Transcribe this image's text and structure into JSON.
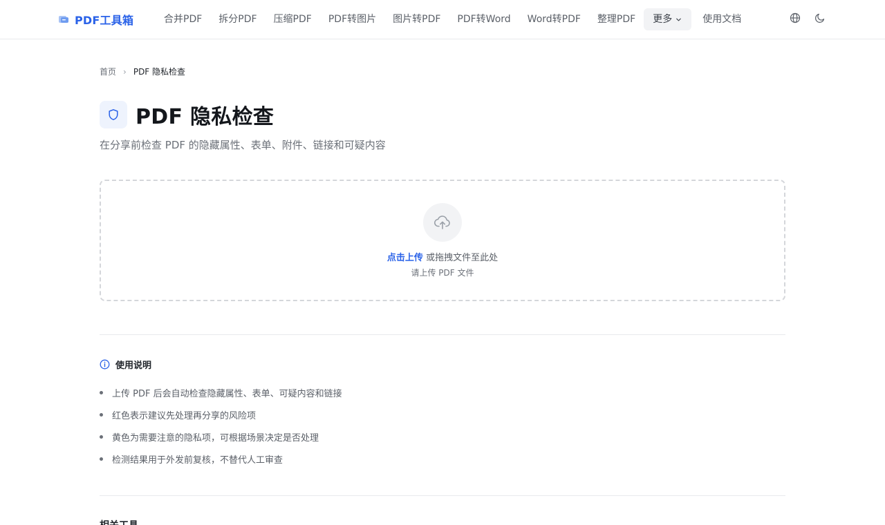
{
  "header": {
    "brand": "PDF工具箱",
    "nav": [
      "合并PDF",
      "拆分PDF",
      "压缩PDF",
      "PDF转图片",
      "图片转PDF",
      "PDF转Word",
      "Word转PDF",
      "整理PDF"
    ],
    "more_label": "更多",
    "docs_label": "使用文档",
    "icons": [
      "globe-icon",
      "moon-icon"
    ]
  },
  "breadcrumb": {
    "home": "首页",
    "separator": "›",
    "current": "PDF 隐私检查"
  },
  "page": {
    "title": "PDF 隐私检查",
    "subtitle": "在分享前检查 PDF 的隐藏属性、表单、附件、链接和可疑内容"
  },
  "upload": {
    "link_text": "点击上传",
    "rest_text": " 或拖拽文件至此处",
    "hint": "请上传 PDF 文件"
  },
  "usage": {
    "title": "使用说明",
    "items": [
      "上传 PDF 后会自动检查隐藏属性、表单、可疑内容和链接",
      "红色表示建议先处理再分享的风险项",
      "黄色为需要注意的隐私项，可根据场景决定是否处理",
      "检测结果用于外发前复核，不替代人工审查"
    ]
  },
  "related": {
    "title": "相关工具"
  },
  "colors": {
    "accent": "#2a62e8",
    "text": "#1f2329",
    "muted": "#6b7078",
    "border": "#e8e9ec"
  }
}
